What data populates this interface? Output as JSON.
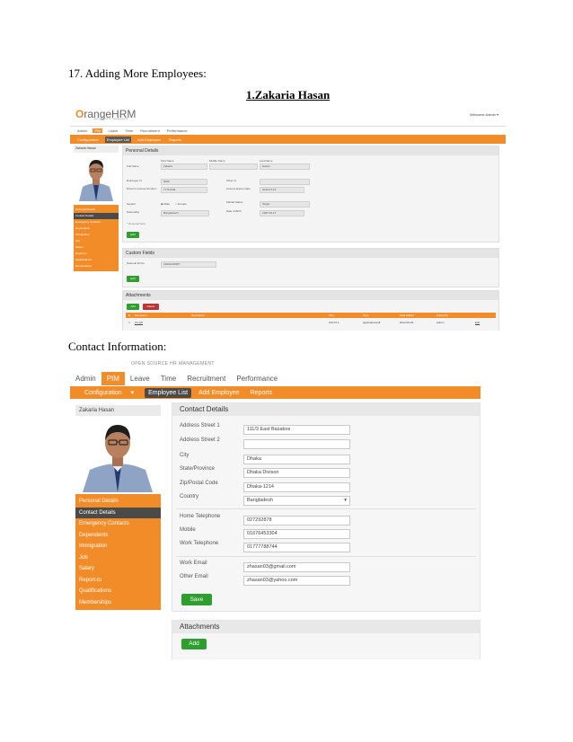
{
  "document": {
    "heading": "17. Adding More Employees:",
    "subheading": "1.Zakaria Hasan",
    "contact_heading": "Contact Information:"
  },
  "screenshot1": {
    "logo_prefix": "O",
    "logo_text": "rangeHRM",
    "logo_tagline": "open source hr management",
    "welcome": "Welcome Admin",
    "main_menu": [
      "Admin",
      "PIM",
      "Leave",
      "Time",
      "Recruitment",
      "Performance"
    ],
    "sub_menu": [
      "Configuration",
      "Employee List",
      "Add Employee",
      "Reports"
    ],
    "employee_name": "Zakaria Hasan",
    "sidebar": [
      "Personal Details",
      "Contact Details",
      "Emergency Contacts",
      "Dependents",
      "Immigration",
      "Job",
      "Salary",
      "Report-to",
      "Qualifications",
      "Memberships"
    ],
    "personal_details": {
      "title": "Personal Details",
      "full_name_label": "Full Name",
      "first_name_label": "First Name",
      "middle_name_label": "Middle Name",
      "last_name_label": "Last Name",
      "first_name": "Zakaria",
      "last_name": "Hasan",
      "employee_id_label": "Employee Id",
      "employee_id": "0009",
      "other_id_label": "Other Id",
      "license_label": "Driver's License Number",
      "license": "77712345",
      "license_exp_label": "License Expiry Date",
      "license_exp": "2016-07-15",
      "gender_label": "Gender",
      "gender_male": "Male",
      "gender_female": "Female",
      "marital_label": "Marital Status",
      "marital": "Single",
      "nationality_label": "Nationality",
      "nationality": "Bangladeshi",
      "dob_label": "Date of Birth",
      "dob": "1987-05-17",
      "required_note": "* Required field",
      "edit": "Edit"
    },
    "custom_fields": {
      "title": "Custom Fields",
      "national_id_label": "National ID No.",
      "national_id": "19901234567",
      "edit": "Edit"
    },
    "attachments": {
      "title": "Attachments",
      "add": "Add",
      "delete": "Delete",
      "columns": [
        "File Name",
        "Description",
        "Size",
        "Type",
        "Date Added",
        "Added By"
      ],
      "row": {
        "file": "CV.pdf",
        "size": "102.47 k",
        "type": "application/pdf",
        "date": "2013-05-04",
        "by": "Admin",
        "action": "Edit"
      }
    }
  },
  "screenshot2": {
    "tagline": "OPEN SOURCE HR MANAGEMENT",
    "main_menu": [
      "Admin",
      "PIM",
      "Leave",
      "Time",
      "Recruitment",
      "Performance"
    ],
    "sub_menu": [
      "Configuration",
      "Employee List",
      "Add Employee",
      "Reports"
    ],
    "employee_name": "Zakaria Hasan",
    "sidebar": [
      "Personal Details",
      "Contact Details",
      "Emergency Contacts",
      "Dependents",
      "Immigration",
      "Job",
      "Salary",
      "Report-to",
      "Qualifications",
      "Memberships"
    ],
    "contact_title": "Contact Details",
    "fields": {
      "street1_label": "Address Street 1",
      "street1": "111/3 East Basabos",
      "street2_label": "Address Street 2",
      "street2": "",
      "city_label": "City",
      "city": "Dhaka",
      "state_label": "State/Province",
      "state": "Dhaka Divison",
      "zip_label": "Zip/Postal Code",
      "zip": "Dhaka-1214",
      "country_label": "Country",
      "country": "Bangladesh",
      "home_label": "Home Telephone",
      "home": "027292878",
      "mobile_label": "Mobile",
      "mobile": "01676453304",
      "work_label": "Work Telephone",
      "work": "01777788744",
      "work_email_label": "Work Email",
      "work_email": "zhasan03@gmail.com",
      "other_email_label": "Other Email",
      "other_email": "zhasan03@yahoo.com"
    },
    "save": "Save",
    "attachments_title": "Attachments",
    "add": "Add"
  }
}
